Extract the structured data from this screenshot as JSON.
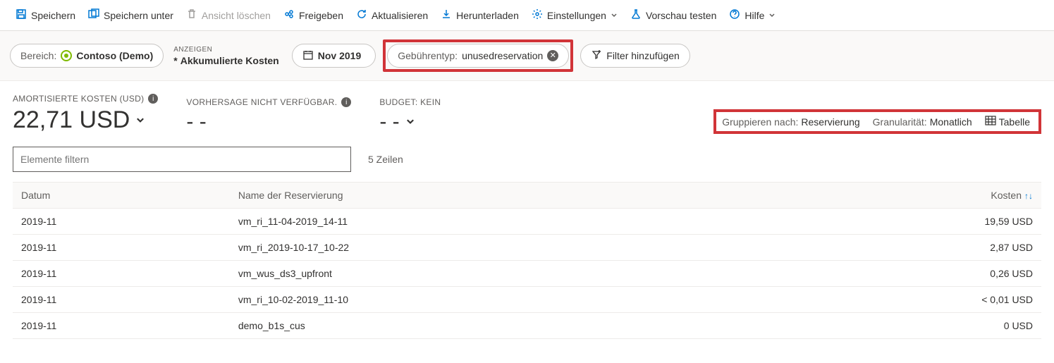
{
  "toolbar": {
    "save": "Speichern",
    "save_as": "Speichern unter",
    "delete_view": "Ansicht löschen",
    "share": "Freigeben",
    "refresh": "Aktualisieren",
    "download": "Herunterladen",
    "settings": "Einstellungen",
    "test_preview": "Vorschau testen",
    "help": "Hilfe"
  },
  "pills": {
    "scope_label": "Bereich:",
    "scope_value": "Contoso (Demo)",
    "show_tiny": "ANZEIGEN",
    "show_value": "Akkumulierte Kosten",
    "show_dirty": "*",
    "date_value": "Nov 2019",
    "filter_label": "Gebührentyp:",
    "filter_value": "unusedreservation",
    "add_filter": "Filter hinzufügen"
  },
  "stats": {
    "amortized_label": "AMORTISIERTE KOSTEN (USD)",
    "amortized_value": "22,71 USD",
    "forecast_label": "VORHERSAGE NICHT VERFÜGBAR.",
    "forecast_value": "- -",
    "budget_label": "BUDGET: KEIN",
    "budget_value": "- -"
  },
  "controls": {
    "group_label": "Gruppieren nach:",
    "group_value": "Reservierung",
    "gran_label": "Granularität:",
    "gran_value": "Monatlich",
    "view_value": "Tabelle"
  },
  "filterbar": {
    "placeholder": "Elemente filtern",
    "row_count": "5 Zeilen"
  },
  "table": {
    "headers": {
      "date": "Datum",
      "name": "Name der Reservierung",
      "cost": "Kosten"
    },
    "rows": [
      {
        "date": "2019-11",
        "name": "vm_ri_11-04-2019_14-11",
        "cost": "19,59 USD"
      },
      {
        "date": "2019-11",
        "name": "vm_ri_2019-10-17_10-22",
        "cost": "2,87 USD"
      },
      {
        "date": "2019-11",
        "name": "vm_wus_ds3_upfront",
        "cost": "0,26 USD"
      },
      {
        "date": "2019-11",
        "name": "vm_ri_10-02-2019_11-10",
        "cost": "< 0,01 USD"
      },
      {
        "date": "2019-11",
        "name": "demo_b1s_cus",
        "cost": "0 USD"
      }
    ]
  }
}
